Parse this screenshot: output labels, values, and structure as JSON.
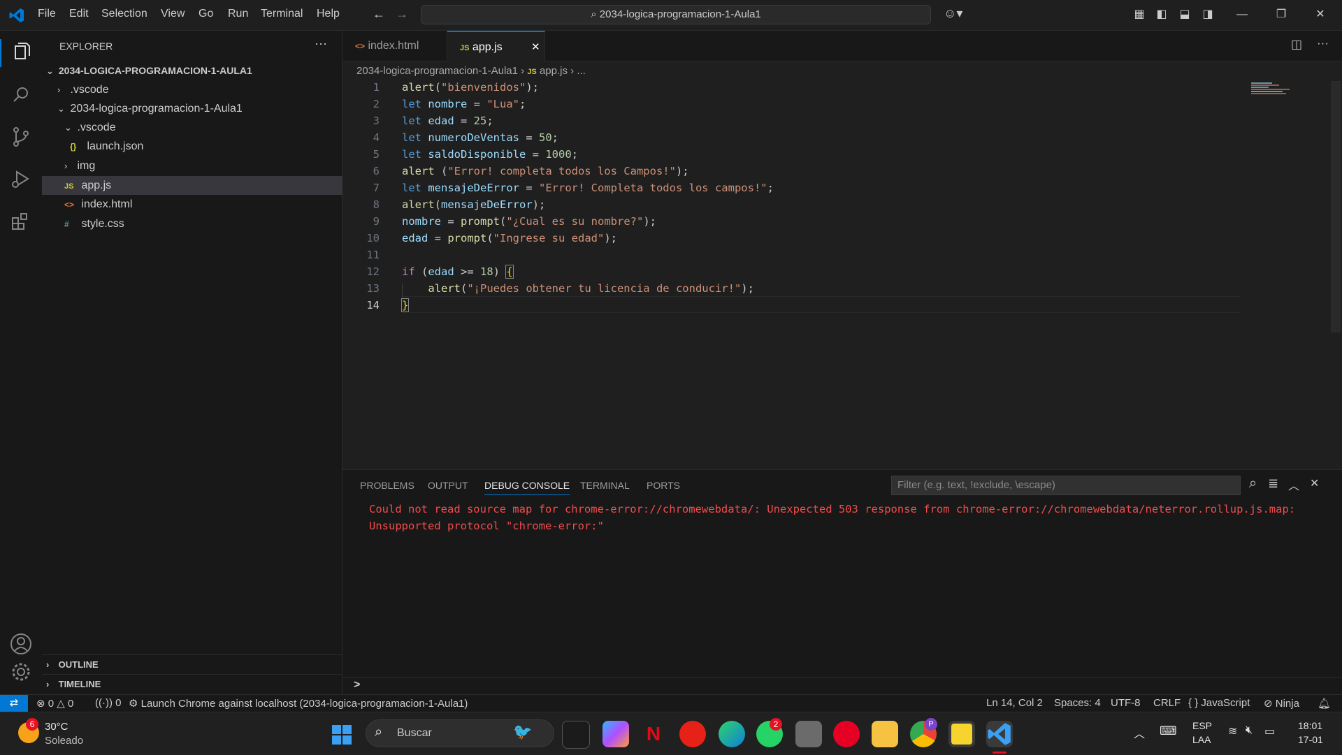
{
  "titlebar": {
    "menus": [
      "File",
      "Edit",
      "Selection",
      "View",
      "Go",
      "Run",
      "Terminal",
      "Help"
    ],
    "search_text": "2034-logica-programacion-1-Aula1"
  },
  "sidebar": {
    "title": "EXPLORER",
    "more": "···",
    "root": "2034-LOGICA-PROGRAMACION-1-AULA1",
    "items": [
      {
        "label": ".vscode",
        "icon": "chevron-right"
      },
      {
        "label": "2034-logica-programacion-1-Aula1",
        "icon": "chevron-down"
      },
      {
        "label": ".vscode",
        "icon": "chevron-down"
      },
      {
        "label": "launch.json",
        "icon": "{}"
      },
      {
        "label": "img",
        "icon": "chevron-right"
      },
      {
        "label": "app.js",
        "icon": "JS"
      },
      {
        "label": "index.html",
        "icon": "<>"
      },
      {
        "label": "style.css",
        "icon": "#"
      }
    ],
    "outline": "OUTLINE",
    "timeline": "TIMELINE"
  },
  "tabs": [
    {
      "label": "index.html",
      "icon": "<>"
    },
    {
      "label": "app.js",
      "icon": "JS",
      "active": true
    }
  ],
  "breadcrumbs": {
    "folder": "2034-logica-programacion-1-Aula1",
    "file": "app.js",
    "rest": "..."
  },
  "editor": {
    "line_numbers": [
      "1",
      "2",
      "3",
      "4",
      "5",
      "6",
      "7",
      "8",
      "9",
      "10",
      "11",
      "12",
      "13",
      "14"
    ]
  },
  "panel": {
    "tabs": [
      "PROBLEMS",
      "OUTPUT",
      "DEBUG CONSOLE",
      "TERMINAL",
      "PORTS"
    ],
    "active_tab": "DEBUG CONSOLE",
    "filter_placeholder": "Filter (e.g. text, !exclude, \\escape)",
    "errors": [
      "Could not read source map for chrome-error://chromewebdata/: Unexpected 503 response from chrome-error://chromewebdata/neterror.rollup.js.map:",
      "Unsupported protocol \"chrome-error:\""
    ],
    "prompt": ">"
  },
  "statusbar": {
    "errors": "0",
    "warnings": "0",
    "ports": "0",
    "launch": "Launch Chrome against localhost (2034-logica-programacion-1-Aula1)",
    "position": "Ln 14, Col 2",
    "spaces": "Spaces: 4",
    "encoding": "UTF-8",
    "eol": "CRLF",
    "language": "JavaScript",
    "ninja": "Ninja"
  },
  "taskbar": {
    "weather_temp": "30°C",
    "weather_desc": "Soleado",
    "weather_badge": "6",
    "search_placeholder": "Buscar",
    "lang_top": "ESP",
    "lang_bottom": "LAA",
    "time": "18:01",
    "date": "17-01",
    "whatsapp_badge": "2",
    "profile_badge": "P"
  },
  "colors": {
    "accent": "#0078d4",
    "error": "#f14c4c",
    "badge": "#e81123"
  }
}
